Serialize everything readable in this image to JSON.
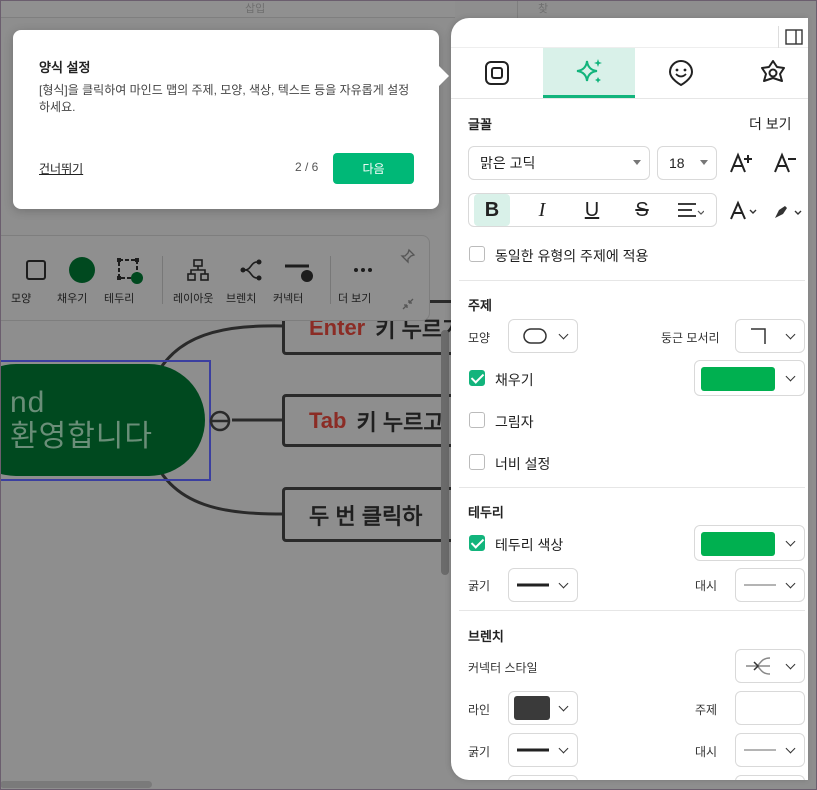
{
  "topbar": {
    "tab_insert": "삽입",
    "tab_find": "찾기"
  },
  "tooltip": {
    "title": "양식 설정",
    "body": "[형식]을 클릭하여 마인드 맵의 주제, 모양, 색상, 텍스트 등을 자유롭게 설정하세요.",
    "skip": "건너뛰기",
    "page": "2 / 6",
    "next": "다음"
  },
  "toolbar": {
    "items": [
      {
        "label": "모양",
        "icon": "square-icon"
      },
      {
        "label": "채우기",
        "icon": "fill-circle-icon"
      },
      {
        "label": "테두리",
        "icon": "border-frame-icon"
      },
      {
        "label": "레이아웃",
        "icon": "layout-tree-icon"
      },
      {
        "label": "브렌치",
        "icon": "branch-icon"
      },
      {
        "label": "커넥터",
        "icon": "connector-icon"
      },
      {
        "label": "더 보기",
        "icon": "more-dots-icon"
      }
    ]
  },
  "mindmap": {
    "central_line1": "nd",
    "central_line2": "환영합니다",
    "topics": [
      {
        "key": "Enter",
        "text": "키 누르기"
      },
      {
        "key": "Tab",
        "text": "키 누르고"
      },
      {
        "key": "",
        "text": "두 번 클릭하"
      }
    ]
  },
  "panel": {
    "tabs": [
      {
        "name": "style",
        "icon": "frame-square-icon"
      },
      {
        "name": "ai",
        "icon": "sparkle-icon",
        "active": true
      },
      {
        "name": "emoji",
        "icon": "emoji-icon"
      },
      {
        "name": "theme",
        "icon": "theme-flower-icon"
      }
    ],
    "font": {
      "section": "글꼴",
      "more": "더 보기",
      "family": "맑은 고딕",
      "size": "18",
      "bold": "B",
      "italic": "I",
      "underline": "U",
      "strike": "S",
      "apply_same": "동일한 유형의 주제에 적용"
    },
    "topic": {
      "section": "주제",
      "shape_label": "모양",
      "corner_label": "둥근 모서리",
      "fill_label": "채우기",
      "fill_color": "#00b050",
      "shadow_label": "그림자",
      "width_label": "너비 설정"
    },
    "border": {
      "section": "테두리",
      "color_label": "테두리 색상",
      "color": "#00b050",
      "weight_label": "굵기",
      "dash_label": "대시"
    },
    "branch": {
      "section": "브렌치",
      "connector_label": "커넥터 스타일",
      "line_label": "라인",
      "line_color": "#3a3a3a",
      "topic_label": "주제",
      "weight_label": "굵기",
      "dash_label": "대시"
    }
  },
  "colors": {
    "accent": "#12b47c",
    "button": "#00b877"
  }
}
